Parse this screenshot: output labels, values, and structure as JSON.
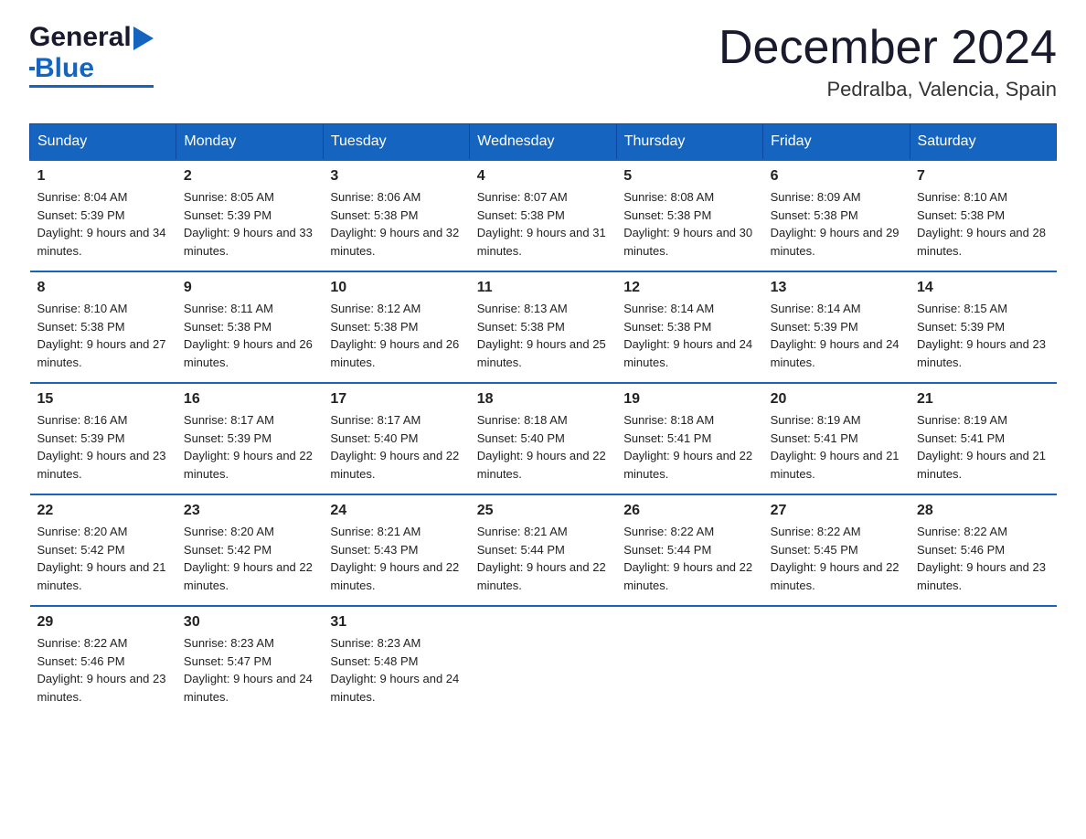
{
  "logo": {
    "text_general": "General",
    "text_blue": "Blue",
    "triangle_symbol": "▶"
  },
  "header": {
    "month_year": "December 2024",
    "location": "Pedralba, Valencia, Spain"
  },
  "weekdays": [
    "Sunday",
    "Monday",
    "Tuesday",
    "Wednesday",
    "Thursday",
    "Friday",
    "Saturday"
  ],
  "weeks": [
    [
      {
        "day": "1",
        "sunrise": "Sunrise: 8:04 AM",
        "sunset": "Sunset: 5:39 PM",
        "daylight": "Daylight: 9 hours and 34 minutes."
      },
      {
        "day": "2",
        "sunrise": "Sunrise: 8:05 AM",
        "sunset": "Sunset: 5:39 PM",
        "daylight": "Daylight: 9 hours and 33 minutes."
      },
      {
        "day": "3",
        "sunrise": "Sunrise: 8:06 AM",
        "sunset": "Sunset: 5:38 PM",
        "daylight": "Daylight: 9 hours and 32 minutes."
      },
      {
        "day": "4",
        "sunrise": "Sunrise: 8:07 AM",
        "sunset": "Sunset: 5:38 PM",
        "daylight": "Daylight: 9 hours and 31 minutes."
      },
      {
        "day": "5",
        "sunrise": "Sunrise: 8:08 AM",
        "sunset": "Sunset: 5:38 PM",
        "daylight": "Daylight: 9 hours and 30 minutes."
      },
      {
        "day": "6",
        "sunrise": "Sunrise: 8:09 AM",
        "sunset": "Sunset: 5:38 PM",
        "daylight": "Daylight: 9 hours and 29 minutes."
      },
      {
        "day": "7",
        "sunrise": "Sunrise: 8:10 AM",
        "sunset": "Sunset: 5:38 PM",
        "daylight": "Daylight: 9 hours and 28 minutes."
      }
    ],
    [
      {
        "day": "8",
        "sunrise": "Sunrise: 8:10 AM",
        "sunset": "Sunset: 5:38 PM",
        "daylight": "Daylight: 9 hours and 27 minutes."
      },
      {
        "day": "9",
        "sunrise": "Sunrise: 8:11 AM",
        "sunset": "Sunset: 5:38 PM",
        "daylight": "Daylight: 9 hours and 26 minutes."
      },
      {
        "day": "10",
        "sunrise": "Sunrise: 8:12 AM",
        "sunset": "Sunset: 5:38 PM",
        "daylight": "Daylight: 9 hours and 26 minutes."
      },
      {
        "day": "11",
        "sunrise": "Sunrise: 8:13 AM",
        "sunset": "Sunset: 5:38 PM",
        "daylight": "Daylight: 9 hours and 25 minutes."
      },
      {
        "day": "12",
        "sunrise": "Sunrise: 8:14 AM",
        "sunset": "Sunset: 5:38 PM",
        "daylight": "Daylight: 9 hours and 24 minutes."
      },
      {
        "day": "13",
        "sunrise": "Sunrise: 8:14 AM",
        "sunset": "Sunset: 5:39 PM",
        "daylight": "Daylight: 9 hours and 24 minutes."
      },
      {
        "day": "14",
        "sunrise": "Sunrise: 8:15 AM",
        "sunset": "Sunset: 5:39 PM",
        "daylight": "Daylight: 9 hours and 23 minutes."
      }
    ],
    [
      {
        "day": "15",
        "sunrise": "Sunrise: 8:16 AM",
        "sunset": "Sunset: 5:39 PM",
        "daylight": "Daylight: 9 hours and 23 minutes."
      },
      {
        "day": "16",
        "sunrise": "Sunrise: 8:17 AM",
        "sunset": "Sunset: 5:39 PM",
        "daylight": "Daylight: 9 hours and 22 minutes."
      },
      {
        "day": "17",
        "sunrise": "Sunrise: 8:17 AM",
        "sunset": "Sunset: 5:40 PM",
        "daylight": "Daylight: 9 hours and 22 minutes."
      },
      {
        "day": "18",
        "sunrise": "Sunrise: 8:18 AM",
        "sunset": "Sunset: 5:40 PM",
        "daylight": "Daylight: 9 hours and 22 minutes."
      },
      {
        "day": "19",
        "sunrise": "Sunrise: 8:18 AM",
        "sunset": "Sunset: 5:41 PM",
        "daylight": "Daylight: 9 hours and 22 minutes."
      },
      {
        "day": "20",
        "sunrise": "Sunrise: 8:19 AM",
        "sunset": "Sunset: 5:41 PM",
        "daylight": "Daylight: 9 hours and 21 minutes."
      },
      {
        "day": "21",
        "sunrise": "Sunrise: 8:19 AM",
        "sunset": "Sunset: 5:41 PM",
        "daylight": "Daylight: 9 hours and 21 minutes."
      }
    ],
    [
      {
        "day": "22",
        "sunrise": "Sunrise: 8:20 AM",
        "sunset": "Sunset: 5:42 PM",
        "daylight": "Daylight: 9 hours and 21 minutes."
      },
      {
        "day": "23",
        "sunrise": "Sunrise: 8:20 AM",
        "sunset": "Sunset: 5:42 PM",
        "daylight": "Daylight: 9 hours and 22 minutes."
      },
      {
        "day": "24",
        "sunrise": "Sunrise: 8:21 AM",
        "sunset": "Sunset: 5:43 PM",
        "daylight": "Daylight: 9 hours and 22 minutes."
      },
      {
        "day": "25",
        "sunrise": "Sunrise: 8:21 AM",
        "sunset": "Sunset: 5:44 PM",
        "daylight": "Daylight: 9 hours and 22 minutes."
      },
      {
        "day": "26",
        "sunrise": "Sunrise: 8:22 AM",
        "sunset": "Sunset: 5:44 PM",
        "daylight": "Daylight: 9 hours and 22 minutes."
      },
      {
        "day": "27",
        "sunrise": "Sunrise: 8:22 AM",
        "sunset": "Sunset: 5:45 PM",
        "daylight": "Daylight: 9 hours and 22 minutes."
      },
      {
        "day": "28",
        "sunrise": "Sunrise: 8:22 AM",
        "sunset": "Sunset: 5:46 PM",
        "daylight": "Daylight: 9 hours and 23 minutes."
      }
    ],
    [
      {
        "day": "29",
        "sunrise": "Sunrise: 8:22 AM",
        "sunset": "Sunset: 5:46 PM",
        "daylight": "Daylight: 9 hours and 23 minutes."
      },
      {
        "day": "30",
        "sunrise": "Sunrise: 8:23 AM",
        "sunset": "Sunset: 5:47 PM",
        "daylight": "Daylight: 9 hours and 24 minutes."
      },
      {
        "day": "31",
        "sunrise": "Sunrise: 8:23 AM",
        "sunset": "Sunset: 5:48 PM",
        "daylight": "Daylight: 9 hours and 24 minutes."
      },
      null,
      null,
      null,
      null
    ]
  ]
}
